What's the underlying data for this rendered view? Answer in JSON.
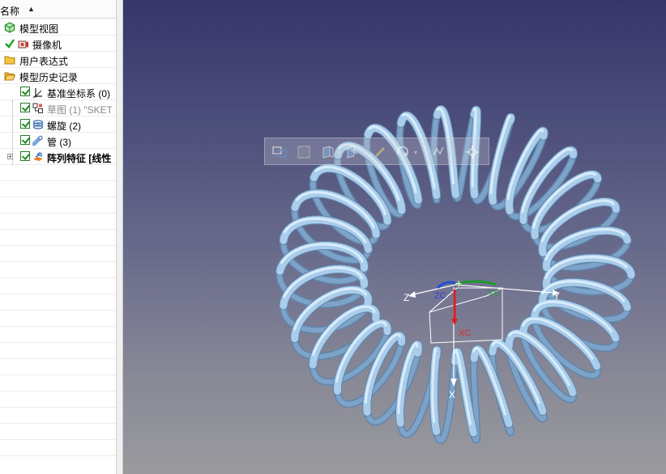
{
  "navigator": {
    "column_header": "名称",
    "sort_icon": "sort-up-arrow-icon",
    "items": [
      {
        "label": "模型视图",
        "icon": "model-view-icon"
      },
      {
        "label": "摄像机",
        "icon": "camera-icon",
        "status": "checkmark"
      },
      {
        "label": "用户表达式",
        "icon": "folder-icon"
      },
      {
        "label": "模型历史记录",
        "icon": "folder-open-icon"
      },
      {
        "label": "基准坐标系 (0)",
        "icon": "datum-csys-icon",
        "checked": true
      },
      {
        "label": "草图 (1) \"SKET",
        "icon": "sketch-icon",
        "checked": true,
        "dimmed": true
      },
      {
        "label": "螺旋 (2)",
        "icon": "helix-icon",
        "checked": true
      },
      {
        "label": "管 (3)",
        "icon": "tube-icon",
        "checked": true
      },
      {
        "label": "阵列特征 [线性",
        "icon": "pattern-feature-icon",
        "checked": true,
        "expandable": true
      }
    ]
  },
  "viewport": {
    "axes": {
      "x": "X",
      "y": "Y",
      "z": "Z",
      "xc": "XC",
      "yc": "YC",
      "zc": "ZC"
    },
    "model_color": "#a9cdea",
    "background_top": "#36366a",
    "background_bottom": "#9a9a9e"
  },
  "toolbar": {
    "icons": [
      "view-triad-icon",
      "display-mode-icon",
      "fit-view-icon",
      "orient-view-icon",
      "snap-icon",
      "rotate-icon",
      "selection-filter-icon",
      "settings-icon"
    ]
  }
}
